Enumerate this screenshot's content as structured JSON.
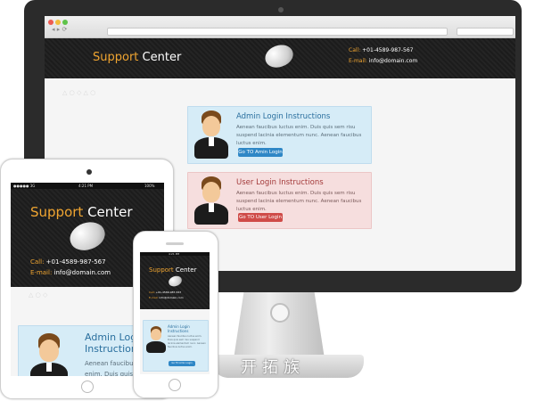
{
  "site": {
    "logo_word1": "Support",
    "logo_word2": "Center",
    "contact_call_label": "Call:",
    "contact_call_value": "+01-4589-987-567",
    "contact_email_label": "E-mail:",
    "contact_email_value": "info@domain.com"
  },
  "admin_card": {
    "title": "Admin Login Instructions",
    "title_line1": "Admin Login",
    "title_line2": "Instructions",
    "body": "Aenean faucibus luctus enim. Duis quis sem risu suspend lacinia elementum nunc. Aenean faucibus luctus enim.",
    "body_short_1": "Aenean faucibus luctus",
    "body_short_2": "enim. Duis quis sem",
    "button": "Go TO Amin Login"
  },
  "user_card": {
    "title": "User Login Instructions",
    "body": "Aenean faucibus luctus enim. Duis quis sem risu suspend lacinia elementum nunc. Aenean faucibus luctus enim.",
    "button": "Go TO User Login"
  },
  "devices": {
    "tablet_status_left": "●●●●● 3G",
    "tablet_status_time": "4:21 PM",
    "tablet_status_right": "100%",
    "phone_status_time": "4:21 PM"
  },
  "watermark": "开拓族",
  "colors": {
    "accent": "#f0a531",
    "header_bg": "#1f1f1f",
    "admin_card_bg": "#d6ecf7",
    "user_card_bg": "#f6dede",
    "admin_button": "#2f87c6",
    "user_button": "#cf4b48"
  }
}
